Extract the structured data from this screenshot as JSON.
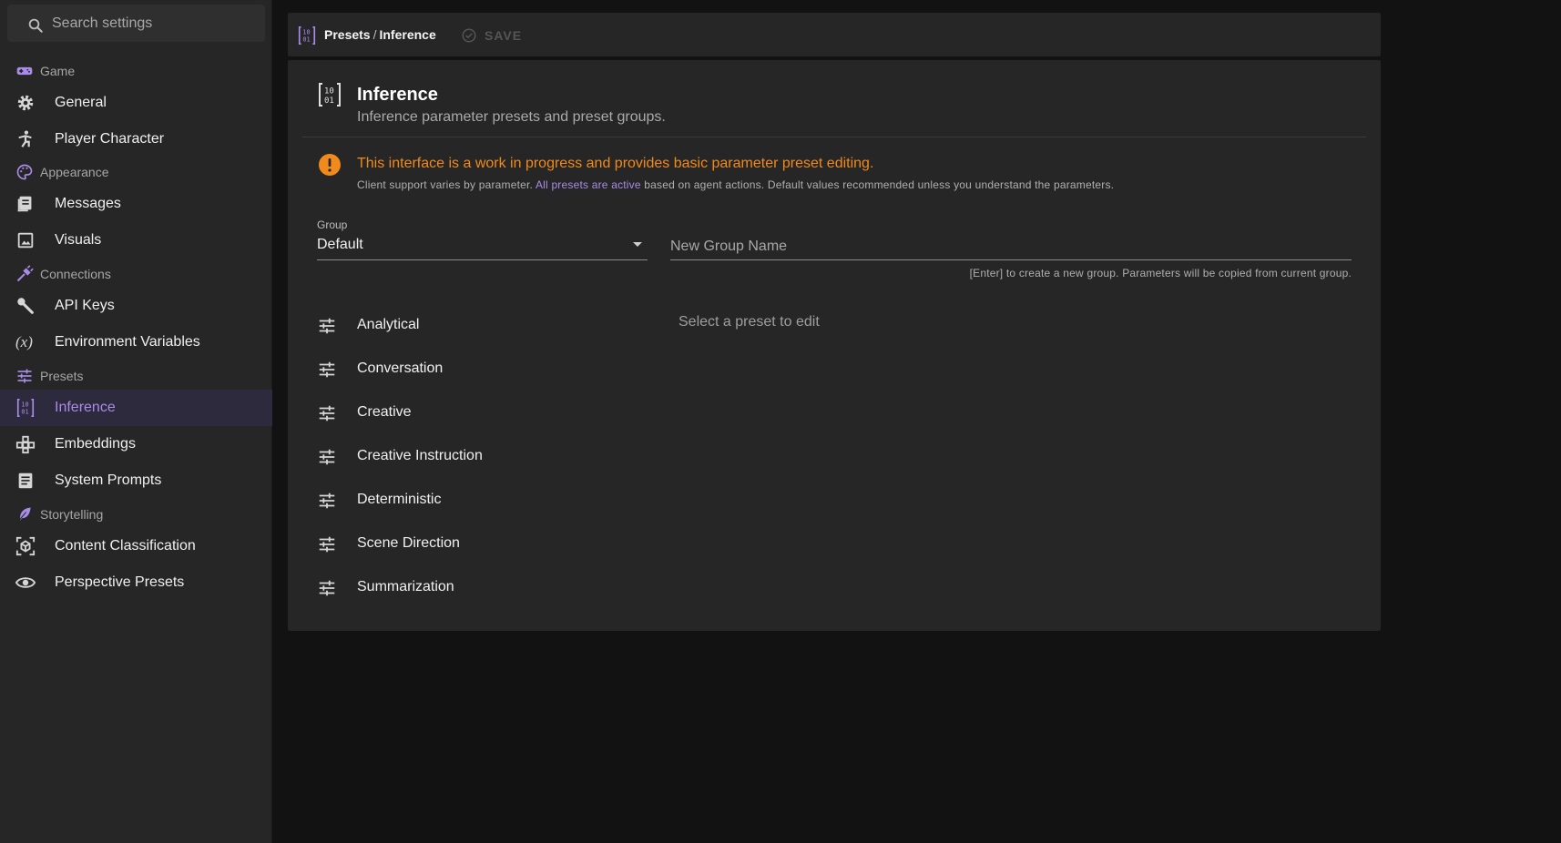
{
  "search": {
    "placeholder": "Search settings"
  },
  "sidebar": {
    "items": [
      {
        "type": "header",
        "label": "Game",
        "icon": "gamepad-icon"
      },
      {
        "type": "link",
        "label": "General",
        "icon": "gear-icon"
      },
      {
        "type": "link",
        "label": "Player Character",
        "icon": "person-icon"
      },
      {
        "type": "header",
        "label": "Appearance",
        "icon": "palette-icon"
      },
      {
        "type": "link",
        "label": "Messages",
        "icon": "messages-icon"
      },
      {
        "type": "link",
        "label": "Visuals",
        "icon": "image-icon"
      },
      {
        "type": "header",
        "label": "Connections",
        "icon": "plug-icon"
      },
      {
        "type": "link",
        "label": "API Keys",
        "icon": "key-icon"
      },
      {
        "type": "link",
        "label": "Environment Variables",
        "icon": "variable-icon"
      },
      {
        "type": "header",
        "label": "Presets",
        "icon": "tune-icon"
      },
      {
        "type": "link",
        "label": "Inference",
        "icon": "binary-icon",
        "active": true
      },
      {
        "type": "link",
        "label": "Embeddings",
        "icon": "hub-icon"
      },
      {
        "type": "link",
        "label": "System Prompts",
        "icon": "document-icon"
      },
      {
        "type": "header",
        "label": "Storytelling",
        "icon": "feather-icon"
      },
      {
        "type": "link",
        "label": "Content Classification",
        "icon": "cube-scan-icon"
      },
      {
        "type": "link",
        "label": "Perspective Presets",
        "icon": "eye-icon"
      }
    ]
  },
  "topbar": {
    "crumb_parent": "Presets",
    "crumb_sep": "/",
    "crumb_current": "Inference",
    "save_label": "SAVE"
  },
  "panel": {
    "title": "Inference",
    "subtitle": "Inference parameter presets and preset groups.",
    "warning_title": "This interface is a work in progress and provides basic parameter preset editing.",
    "warning_pre": "Client support varies by parameter. ",
    "warning_link": "All presets are active",
    "warning_post": " based on agent actions. Default values recommended unless you understand the parameters.",
    "group_label": "Group",
    "group_value": "Default",
    "new_group_placeholder": "New Group Name",
    "new_group_hint": "[Enter] to create a new group. Parameters will be copied from current group.",
    "presets": [
      "Analytical",
      "Conversation",
      "Creative",
      "Creative Instruction",
      "Deterministic",
      "Scene Direction",
      "Summarization"
    ],
    "empty_hint": "Select a preset to edit"
  },
  "colors": {
    "accent": "#a98be8",
    "warning": "#f08a1c",
    "background": "#121212",
    "surface": "#262626"
  }
}
